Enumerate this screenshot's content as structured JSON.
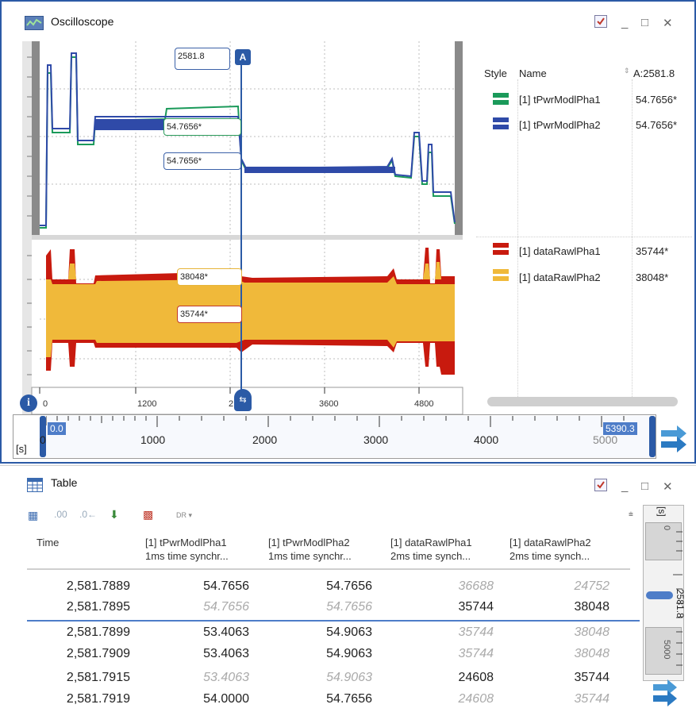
{
  "osc": {
    "title": "Oscilloscope",
    "cursor_label": "A",
    "cursor_time": "2581.8",
    "values": {
      "green": "54.7656*",
      "blue": "54.7656*",
      "yellow": "38048*",
      "red": "35744*"
    },
    "legend": {
      "col_style": "Style",
      "col_name": "Name",
      "col_cursor": "A:2581.8",
      "items": [
        {
          "name": "[1] tPwrModlPha1",
          "value": "54.7656*",
          "color": "#1b9a5a"
        },
        {
          "name": "[1] tPwrModlPha2",
          "value": "54.7656*",
          "color": "#2f4aa8"
        },
        {
          "name": "[1] dataRawlPha1",
          "value": "35744*",
          "color": "#c81a0e"
        },
        {
          "name": "[1] dataRawlPha2",
          "value": "38048*",
          "color": "#f0b93a"
        }
      ]
    },
    "xticks": [
      "0",
      "1200",
      "2",
      "3600",
      "4800"
    ],
    "overview": {
      "unit": "[s]",
      "zero": "0",
      "start": "0.0",
      "end": "5390.3",
      "ticks": [
        "1000",
        "2000",
        "3000",
        "4000",
        "5000"
      ]
    }
  },
  "table": {
    "title": "Table",
    "toolbar_dr": "DR ▾",
    "columns": [
      {
        "name": "Time",
        "sub": ""
      },
      {
        "name": "[1] tPwrModlPha1",
        "sub": "1ms time synchr..."
      },
      {
        "name": "[1] tPwrModlPha2",
        "sub": "1ms time synchr..."
      },
      {
        "name": "[1] dataRawlPha1",
        "sub": "2ms time synch..."
      },
      {
        "name": "[1] dataRawlPha2",
        "sub": "2ms time synch..."
      }
    ],
    "rows": [
      {
        "time": "2,581.7889",
        "c1": "54.7656",
        "c2": "54.7656",
        "c3": "36688",
        "c4": "24752"
      },
      {
        "time": "2,581.7895",
        "c1": "54.7656",
        "c2": "54.7656",
        "c3": "35744",
        "c4": "38048"
      },
      {
        "time": "2,581.7899",
        "c1": "53.4063",
        "c2": "54.9063",
        "c3": "35744",
        "c4": "38048"
      },
      {
        "time": "2,581.7909",
        "c1": "53.4063",
        "c2": "54.9063",
        "c3": "35744",
        "c4": "38048"
      },
      {
        "time": "2,581.7915",
        "c1": "53.4063",
        "c2": "54.9063",
        "c3": "24608",
        "c4": "35744"
      },
      {
        "time": "2,581.7919",
        "c1": "54.0000",
        "c2": "54.7656",
        "c3": "24608",
        "c4": "35744"
      }
    ],
    "side": {
      "unit": "[s]",
      "top": "0",
      "mid": "2581.8",
      "bottom": "5000"
    }
  }
}
